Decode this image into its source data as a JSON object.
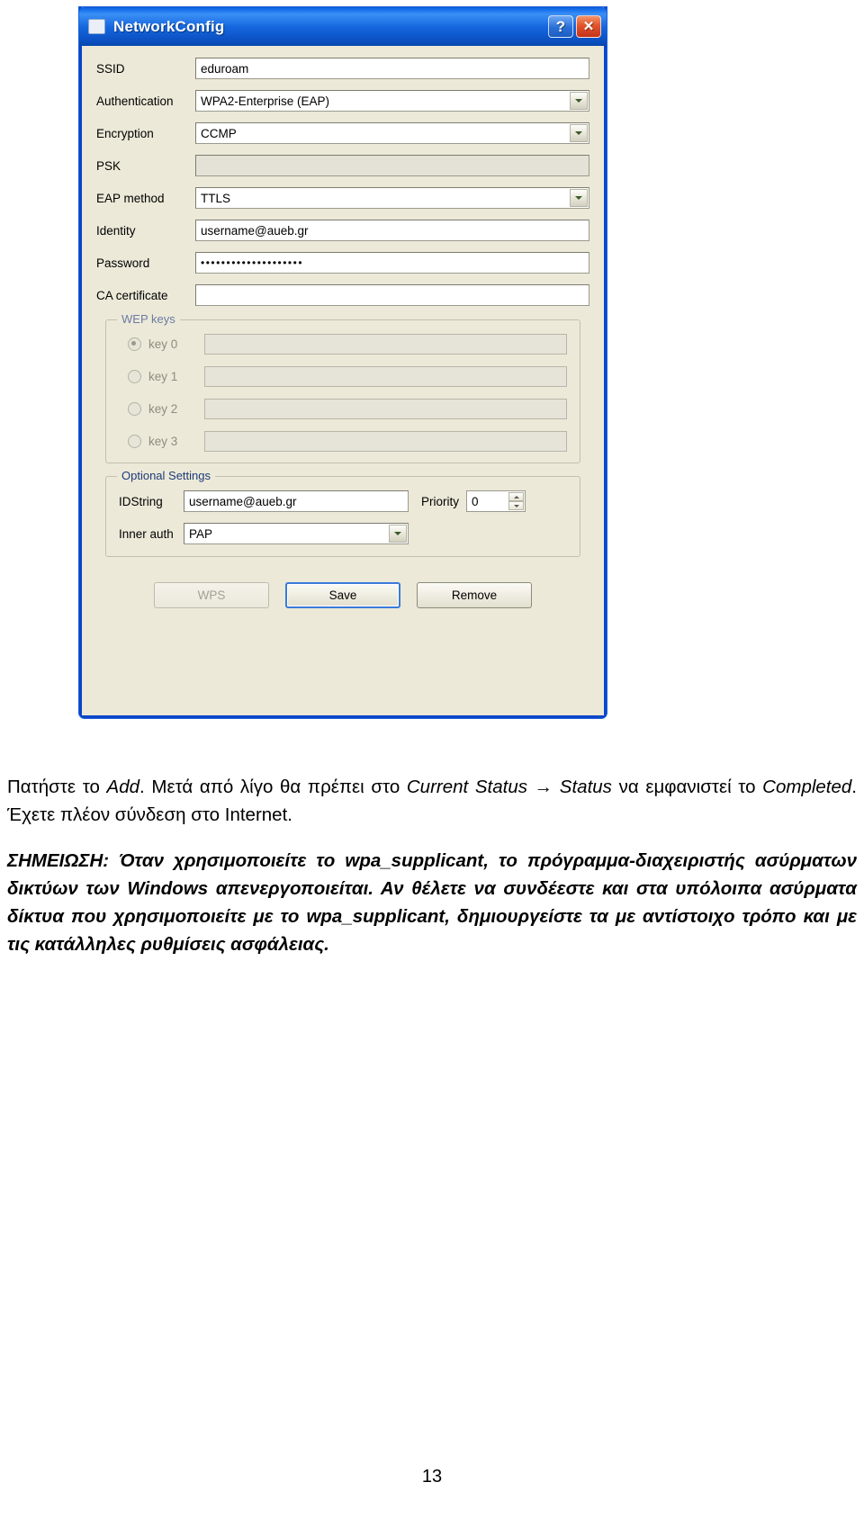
{
  "dialog": {
    "title": "NetworkConfig",
    "titlebar_buttons": [
      {
        "name": "help",
        "glyph": "?"
      },
      {
        "name": "close",
        "glyph": "✕"
      }
    ],
    "fields": [
      {
        "label": "SSID",
        "type": "text",
        "value": "eduroam",
        "enabled": true
      },
      {
        "label": "Authentication",
        "type": "combobox",
        "value": "WPA2-Enterprise (EAP)",
        "enabled": true
      },
      {
        "label": "Encryption",
        "type": "combobox",
        "value": "CCMP",
        "enabled": true
      },
      {
        "label": "PSK",
        "type": "text",
        "value": "",
        "enabled": false
      },
      {
        "label": "EAP method",
        "type": "combobox",
        "value": "TTLS",
        "enabled": true
      },
      {
        "label": "Identity",
        "type": "text",
        "value": "username@aueb.gr",
        "enabled": true
      },
      {
        "label": "Password",
        "type": "password",
        "value": "••••••••••••••••••••",
        "enabled": true
      },
      {
        "label": "CA certificate",
        "type": "text",
        "value": "",
        "enabled": true
      }
    ],
    "wep_keys_group": {
      "title": "WEP keys",
      "enabled": false,
      "keys": [
        {
          "label": "key 0",
          "selected": true,
          "value": ""
        },
        {
          "label": "key 1",
          "selected": false,
          "value": ""
        },
        {
          "label": "key 2",
          "selected": false,
          "value": ""
        },
        {
          "label": "key 3",
          "selected": false,
          "value": ""
        }
      ]
    },
    "optional_settings_group": {
      "title": "Optional Settings",
      "idstring_label": "IDString",
      "idstring_value": "username@aueb.gr",
      "priority_label": "Priority",
      "priority_value": "0",
      "inner_auth_label": "Inner auth",
      "inner_auth_value": "PAP"
    },
    "buttons": [
      {
        "label": "WPS",
        "state": "disabled"
      },
      {
        "label": "Save",
        "state": "focused"
      },
      {
        "label": "Remove",
        "state": "normal"
      }
    ]
  },
  "body_text": {
    "paragraph_1_parts": [
      {
        "text": "Πατήστε το ",
        "italic": false
      },
      {
        "text": "Add",
        "italic": true
      },
      {
        "text": ". Μετά από λίγο θα πρέπει στο ",
        "italic": false
      },
      {
        "text": "Current Status",
        "italic": true
      },
      {
        "text": " → ",
        "italic": false
      },
      {
        "text": "Status",
        "italic": true
      },
      {
        "text": " να εμφανιστεί το ",
        "italic": false
      },
      {
        "text": "Completed",
        "italic": true
      },
      {
        "text": ". Έχετε πλέον σύνδεση στο Internet.",
        "italic": false
      }
    ],
    "paragraph_1_plain": "Πατήστε το Add. Μετά από λίγο θα πρέπει στο Current Status → Status να εμφανιστεί το Completed. Έχετε πλέον σύνδεση στο Internet.",
    "paragraph_2": "ΣΗΜΕΙΩΣΗ: Όταν χρησιμοποιείτε το wpa_supplicant, το πρόγραμμα-διαχειριστής ασύρματων δικτύων των Windows απενεργοποιείται. Αν θέλετε να συνδέεστε και στα υπόλοιπα ασύρματα δίκτυα που χρησιμοποιείτε με το wpa_supplicant, δημιουργείστε τα με αντίστοιχο τρόπο και με τις κατάλληλες ρυθμίσεις ασφάλειας."
  },
  "page_number": "13"
}
